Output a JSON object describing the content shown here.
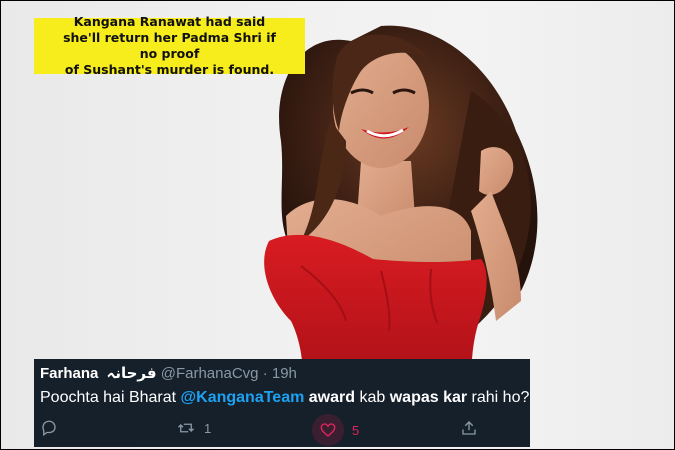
{
  "caption": {
    "line1": "Kangana Ranawat had said",
    "line2": "she'll return her Padma Shri if no proof",
    "line3": "of Sushant's murder is found."
  },
  "tweet": {
    "name": "Farhana",
    "name_urdu": "فرحانہ",
    "handle": "@FarhanaCvg",
    "separator": "·",
    "time": "19h",
    "body": {
      "part1": "Poochta hai Bharat ",
      "mention": "@KanganaTeam",
      "part2": " ",
      "bold1": "award",
      "part3": " kab ",
      "bold2": "wapas kar",
      "part4": " rahi ho?"
    },
    "actions": {
      "reply_icon": "reply-icon",
      "retweet_icon": "retweet-icon",
      "retweet_count": "1",
      "like_icon": "heart-icon",
      "like_count": "5",
      "share_icon": "share-icon"
    }
  },
  "colors": {
    "caption_bg": "#f7ec1c",
    "tweet_bg": "#15202b",
    "mention": "#1da1f2",
    "like": "#e0245e",
    "muted": "#8899a6",
    "dress": "#c8141c"
  }
}
